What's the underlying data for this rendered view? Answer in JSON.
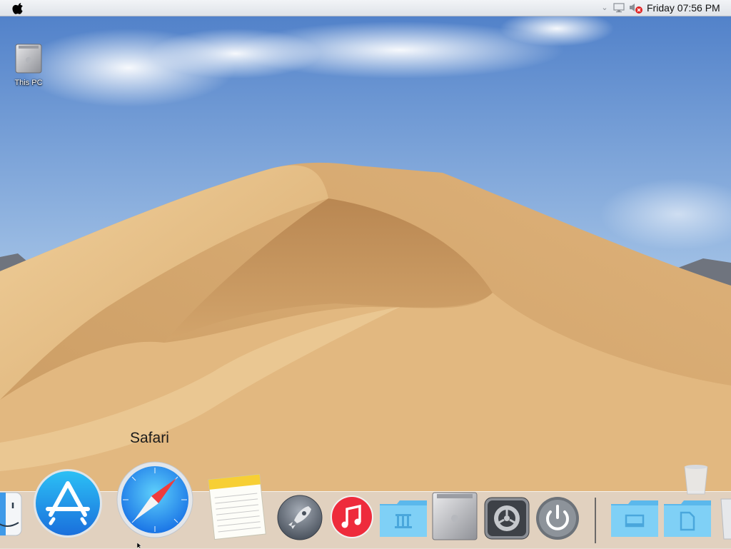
{
  "menubar": {
    "clock": "Friday 07:56 PM"
  },
  "desktop": {
    "icons": [
      {
        "label": "This PC",
        "icon": "mac-pro-icon"
      }
    ]
  },
  "dock": {
    "tooltip": "Safari",
    "items": [
      {
        "name": "Finder",
        "icon": "finder-icon"
      },
      {
        "name": "App Store",
        "icon": "app-store-icon"
      },
      {
        "name": "Safari",
        "icon": "safari-icon"
      },
      {
        "name": "Notes",
        "icon": "notes-icon"
      },
      {
        "name": "Launchpad",
        "icon": "launchpad-icon"
      },
      {
        "name": "iTunes",
        "icon": "itunes-icon"
      },
      {
        "name": "Applications",
        "icon": "applications-folder-icon"
      },
      {
        "name": "This PC",
        "icon": "mac-pro-icon"
      },
      {
        "name": "System Preferences",
        "icon": "system-preferences-icon"
      },
      {
        "name": "Shut Down",
        "icon": "power-icon"
      },
      {
        "name": "Desktop",
        "icon": "desktop-folder-icon"
      },
      {
        "name": "Documents",
        "icon": "documents-folder-icon"
      },
      {
        "name": "Trash",
        "icon": "trash-icon"
      }
    ]
  },
  "colors": {
    "sky_top": "#4f7fc6",
    "sky_bottom": "#c9dcee",
    "sand_light": "#e8c592",
    "sand_dark": "#b88a55",
    "dock_bg": "#e1d7cd",
    "itunes_red": "#ee2b3c",
    "folder_blue": "#6fc6f2"
  }
}
